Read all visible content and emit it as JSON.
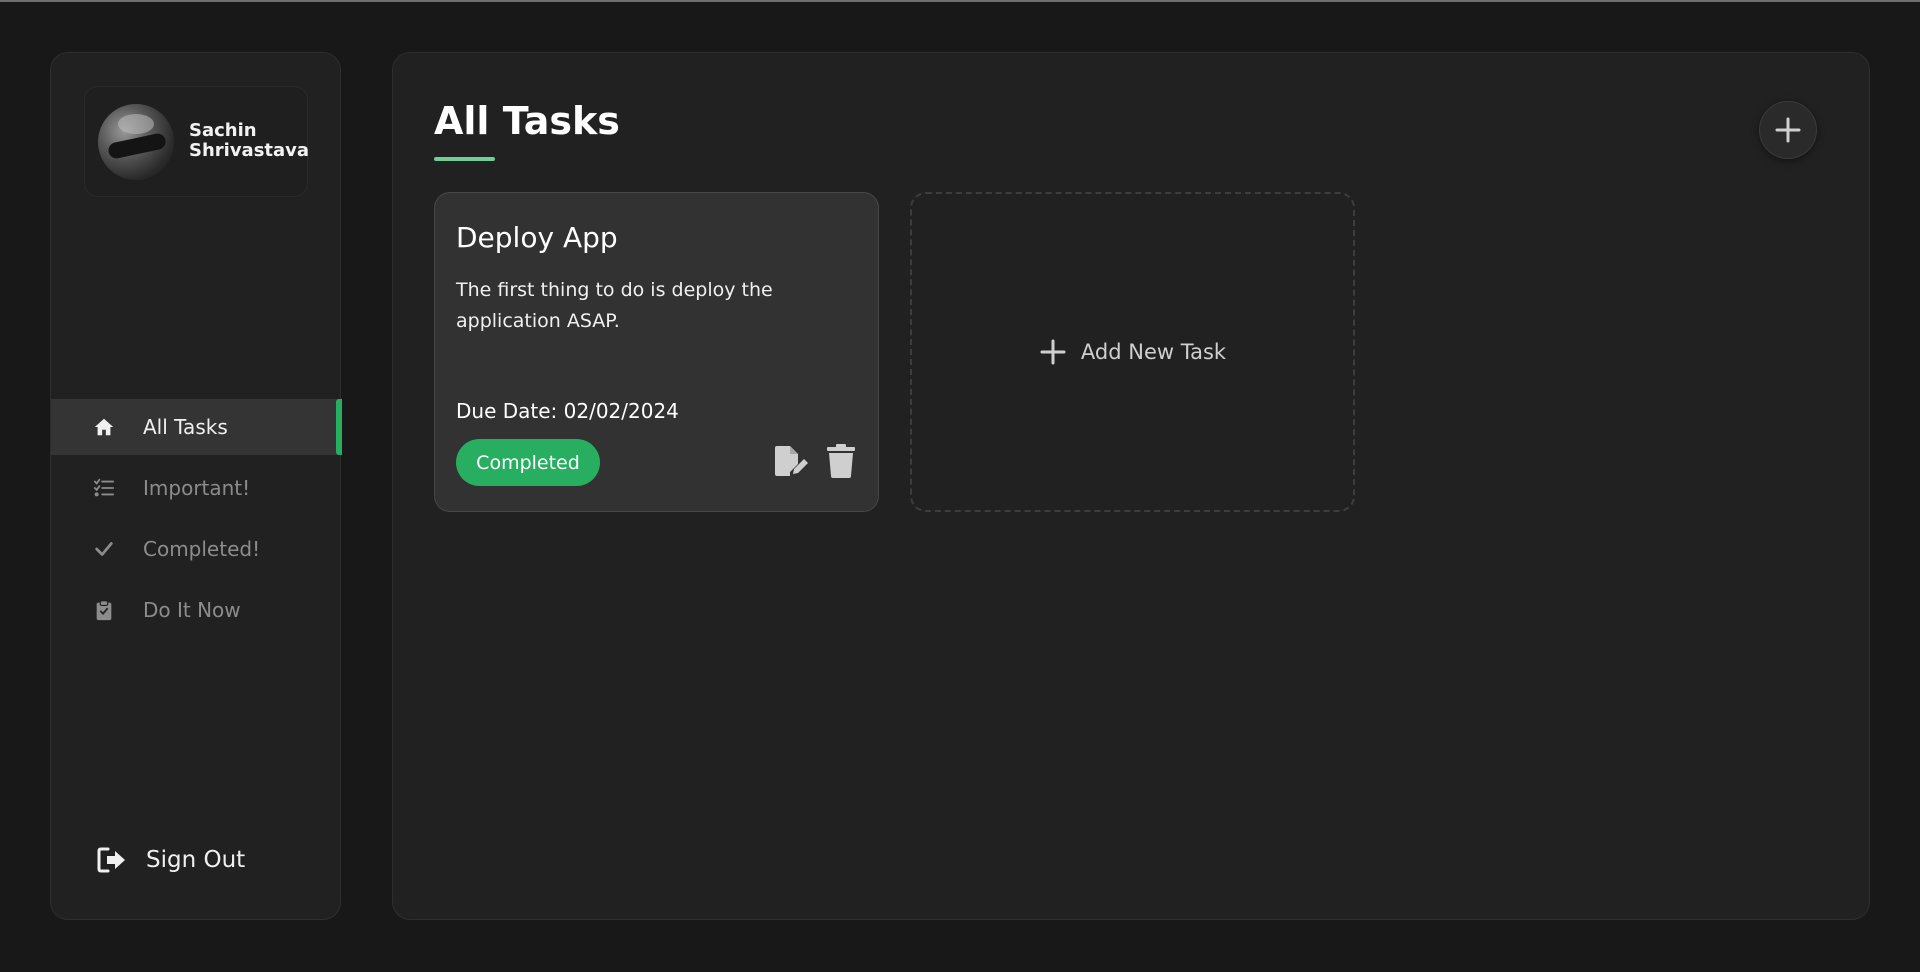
{
  "user": {
    "name": "Sachin Shrivastava"
  },
  "nav": {
    "items": [
      {
        "label": "All Tasks",
        "icon": "home-icon",
        "active": true
      },
      {
        "label": "Important!",
        "icon": "list-check-icon",
        "active": false
      },
      {
        "label": "Completed!",
        "icon": "check-icon",
        "active": false
      },
      {
        "label": "Do It Now",
        "icon": "clipboard-icon",
        "active": false
      }
    ],
    "sign_out": "Sign Out"
  },
  "main": {
    "title": "All Tasks",
    "add_button_icon": "plus-icon",
    "tasks": [
      {
        "title": "Deploy App",
        "description": "The first thing to do is deploy the application ASAP.",
        "due": "Due Date: 02/02/2024",
        "status": "Completed"
      }
    ],
    "add_task_label": "Add New Task"
  },
  "colors": {
    "accent": "#27ae60",
    "underline": "#6fcf97",
    "background": "#181818",
    "panel": "#212121",
    "card": "#323232"
  }
}
